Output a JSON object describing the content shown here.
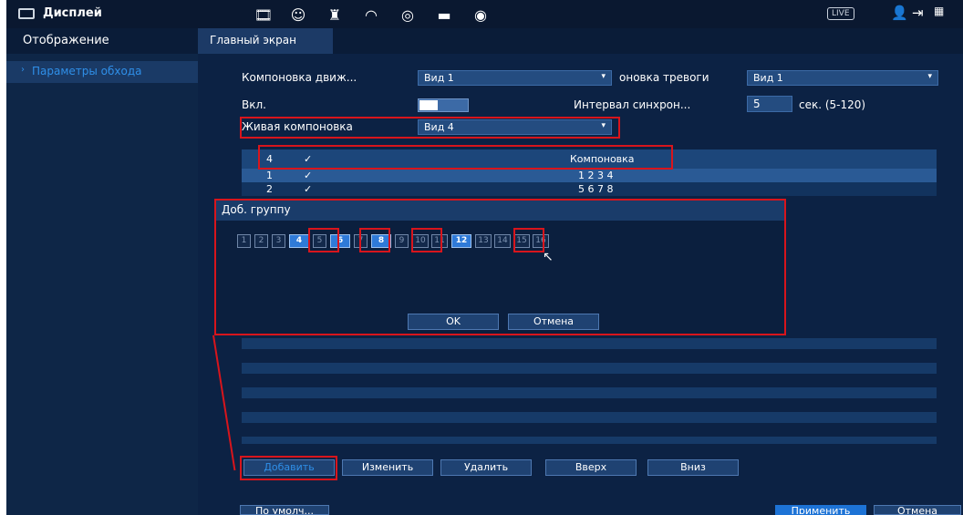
{
  "topbar": {
    "title": "Дисплей",
    "icons": [
      "film-icon",
      "face-icon",
      "alarm-light-icon",
      "speedometer-icon",
      "record-icon",
      "monitor-icon",
      "speaker-icon"
    ],
    "live_label": "LIVE",
    "right_icons": [
      "user-icon",
      "logout-icon",
      "qr-icon"
    ]
  },
  "sidebar": {
    "header": "Отображение",
    "items": [
      {
        "label": "Параметры обхода",
        "active": true
      }
    ]
  },
  "tabs": [
    {
      "label": "Главный экран",
      "active": true
    }
  ],
  "form": {
    "motion_layout_label": "Компоновка движ...",
    "motion_layout_value": "Вид 1",
    "alarm_layout_label": "оновка тревоги",
    "alarm_layout_value": "Вид 1",
    "enable_label": "Вкл.",
    "sync_interval_label": "Интервал синхрон...",
    "sync_interval_value": "5",
    "sync_interval_unit": "сек. (5-120)",
    "live_layout_label": "Живая компоновка",
    "live_layout_value": "Вид 4"
  },
  "table": {
    "columns": [
      "4",
      "✓",
      "Компоновка"
    ],
    "rows": [
      {
        "num": "1",
        "check": "✓",
        "layout": "1 2 3 4"
      },
      {
        "num": "2",
        "check": "✓",
        "layout": "5 6 7 8"
      }
    ]
  },
  "dialog": {
    "title": "Доб. группу",
    "channels": [
      {
        "n": "1",
        "on": false
      },
      {
        "n": "2",
        "on": false
      },
      {
        "n": "3",
        "on": false
      },
      {
        "n": "4",
        "on": true
      },
      {
        "n": "5",
        "on": false
      },
      {
        "n": "6",
        "on": true
      },
      {
        "n": "7",
        "on": false
      },
      {
        "n": "8",
        "on": true
      },
      {
        "n": "9",
        "on": false
      },
      {
        "n": "10",
        "on": false
      },
      {
        "n": "11",
        "on": false
      },
      {
        "n": "12",
        "on": true
      },
      {
        "n": "13",
        "on": false
      },
      {
        "n": "14",
        "on": false
      },
      {
        "n": "15",
        "on": false
      },
      {
        "n": "16",
        "on": false
      }
    ],
    "ok_label": "OK",
    "cancel_label": "Отмена"
  },
  "actions": {
    "add": "Добавить",
    "edit": "Изменить",
    "delete": "Удалить",
    "up": "Вверх",
    "down": "Вниз"
  },
  "footer": {
    "default": "По умолч...",
    "apply": "Применить",
    "cancel": "Отмена"
  },
  "colors": {
    "highlight": "#d8151c",
    "accent": "#2f8fe8"
  }
}
